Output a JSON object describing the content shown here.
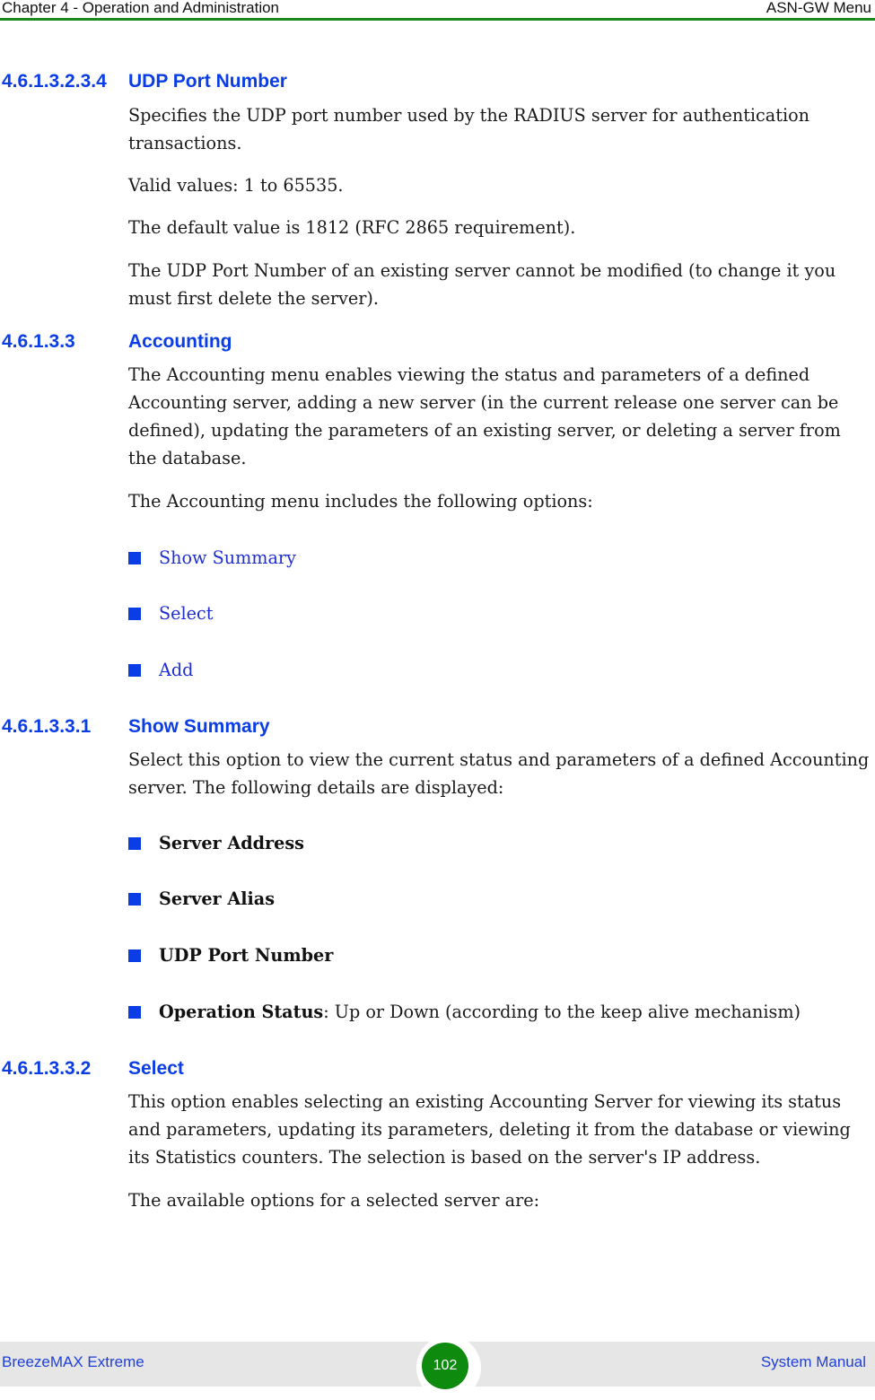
{
  "header": {
    "chapter": "Chapter 4 - Operation and Administration",
    "section": "ASN-GW Menu",
    "rule_color": "#1a8a1a"
  },
  "sections": [
    {
      "number": "4.6.1.3.2.3.4",
      "title": "UDP Port Number",
      "paragraphs": [
        "Specifies the UDP port number used by the RADIUS server for authentication transactions.",
        "Valid values: 1 to 65535.",
        "The default value is 1812 (RFC 2865 requirement).",
        "The UDP Port Number of an existing server cannot be modified (to change it you must first delete the server)."
      ]
    },
    {
      "number": "4.6.1.3.3",
      "title": "Accounting",
      "paragraphs": [
        "The Accounting menu enables viewing the status and parameters of a defined Accounting server, adding a new server (in the current release one server can be defined), updating the parameters of an existing server, or deleting a server from the database.",
        "The Accounting menu includes the following options:"
      ],
      "links": [
        "Show Summary",
        "Select",
        "Add"
      ]
    },
    {
      "number": "4.6.1.3.3.1",
      "title": "Show Summary",
      "paragraphs": [
        "Select this option to view the current status and parameters of a defined Accounting server. The following details are displayed:"
      ],
      "items": [
        {
          "bold": "Server Address",
          "rest": ""
        },
        {
          "bold": "Server Alias",
          "rest": ""
        },
        {
          "bold": "UDP Port Number",
          "rest": ""
        },
        {
          "bold": "Operation Status",
          "rest": ": Up or Down (according to the keep alive mechanism)"
        }
      ]
    },
    {
      "number": "4.6.1.3.3.2",
      "title": "Select",
      "paragraphs": [
        "This option enables selecting an existing Accounting Server for viewing its status and parameters, updating its parameters, deleting it from the database or viewing its Statistics counters. The selection is based on the server's IP address.",
        "The available options for a selected server are:"
      ]
    }
  ],
  "footer": {
    "product": "BreezeMAX Extreme",
    "page_number": "102",
    "doc_type": "System Manual"
  },
  "colors": {
    "heading": "#0a3de6",
    "link": "#1f2ed1",
    "page_badge": "#0e8a0e"
  }
}
